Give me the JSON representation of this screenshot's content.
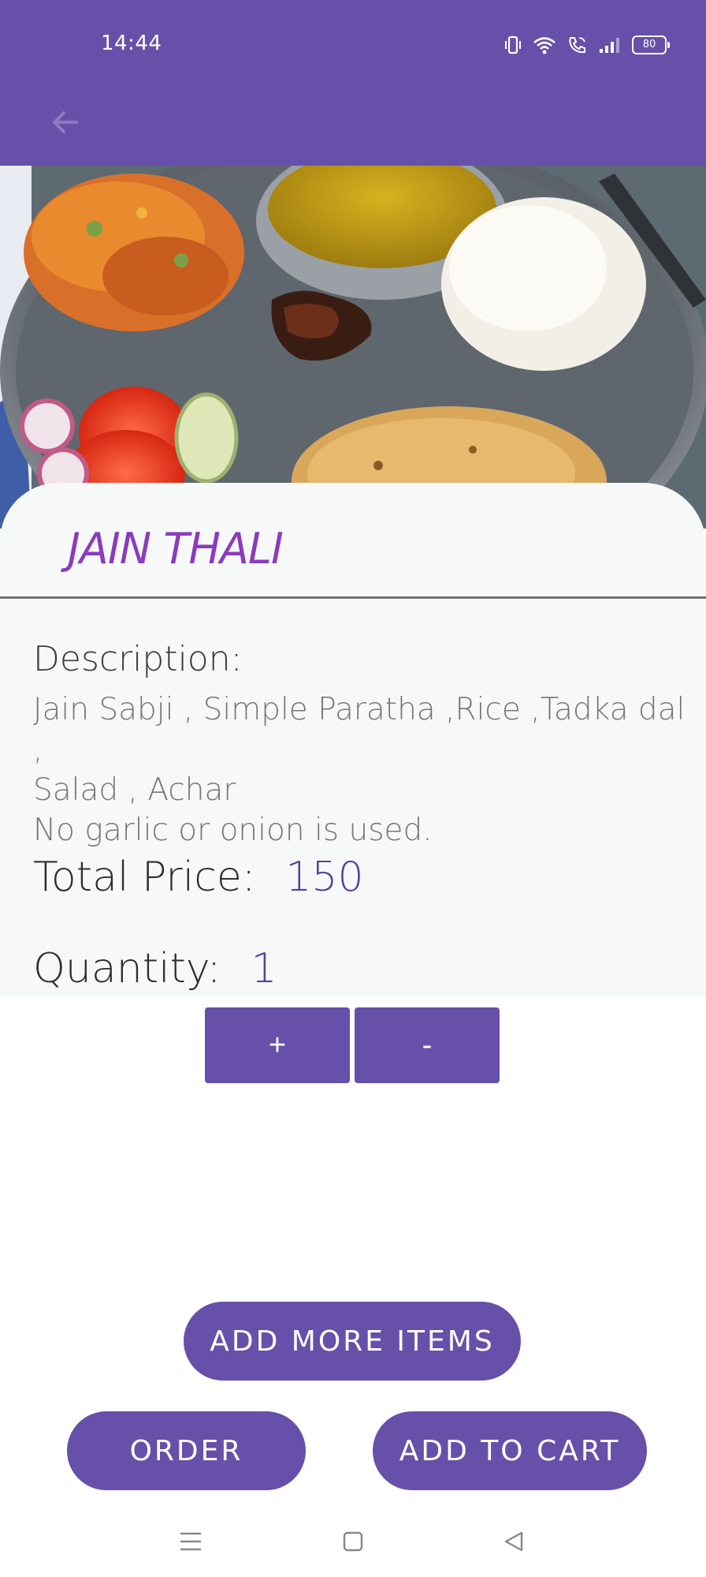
{
  "status_bar": {
    "time": "14:44",
    "battery": "80",
    "icons": [
      "vibrate-icon",
      "wifi-icon",
      "wifi-call-icon",
      "signal-icon",
      "battery-icon"
    ]
  },
  "app_bar": {
    "back_icon": "arrow-left-icon"
  },
  "hero": {
    "image": "thali-plate-photo"
  },
  "item": {
    "title": "JAIN THALI",
    "description_label": "Description:",
    "description_text": "Jain Sabji , Simple Paratha ,Rice ,Tadka dal ,\nSalad , Achar\nNo garlic or onion is used.",
    "price_label": "Total Price:",
    "price_value": "150",
    "quantity_label": "Quantity:",
    "quantity_value": "1"
  },
  "stepper": {
    "plus_label": "+",
    "minus_label": "-"
  },
  "actions": {
    "add_more_label": "ADD MORE ITEMS",
    "order_label": "ORDER",
    "add_to_cart_label": "ADD TO CART"
  },
  "nav": {
    "icons": [
      "menu-icon",
      "home-icon",
      "back-icon"
    ]
  },
  "colors": {
    "primary": "#6750a9",
    "title": "#8b3bbe",
    "card": "#f7f8f8"
  }
}
